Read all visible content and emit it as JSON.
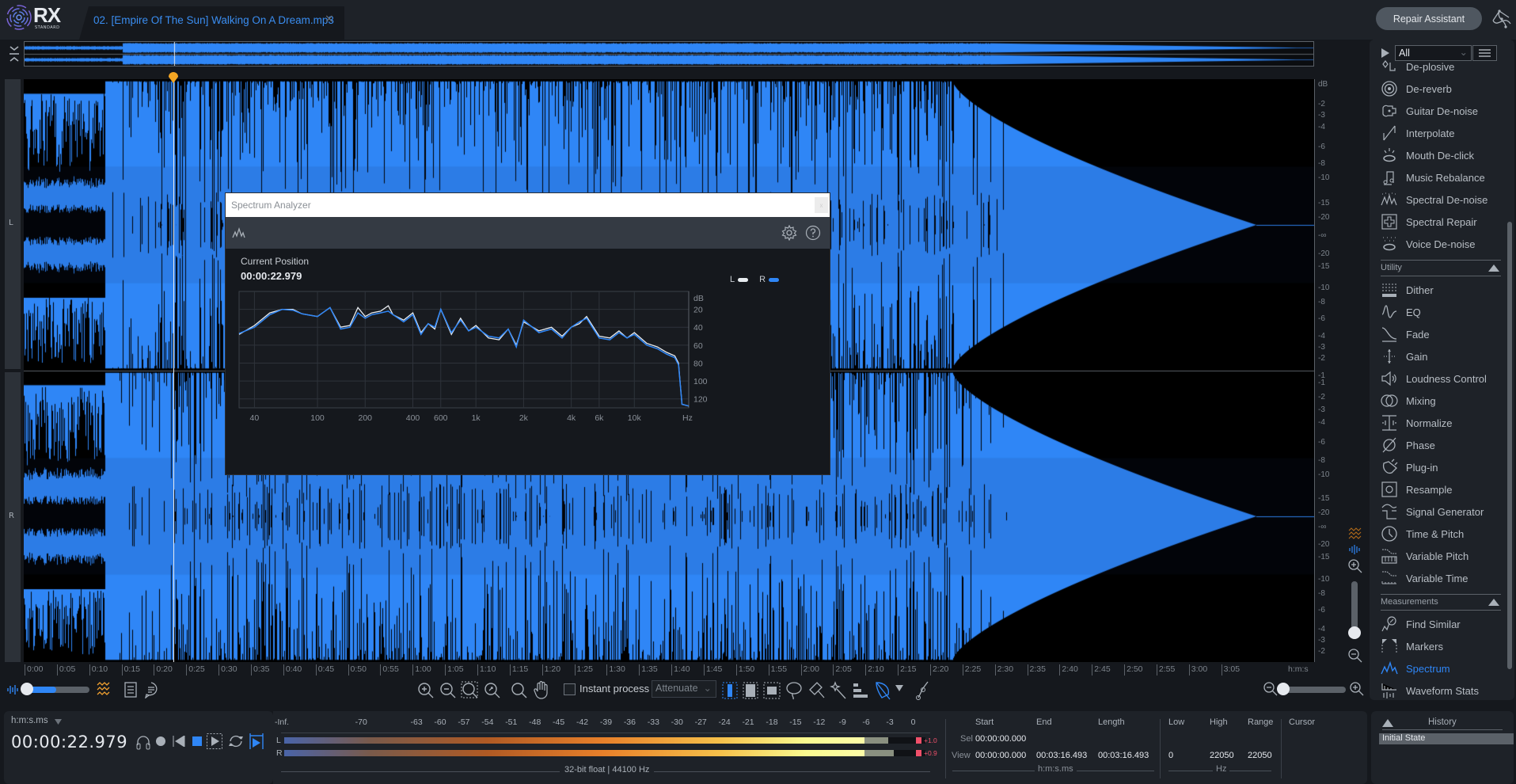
{
  "app": {
    "name": "RX",
    "edition": "STANDARD"
  },
  "tab": {
    "label": "02. [Empire Of The Sun] Walking On A Dream.mp3",
    "close_icon": "×"
  },
  "header": {
    "repair_assistant_label": "Repair Assistant"
  },
  "waveform": {
    "channels": [
      "L",
      "R"
    ],
    "playhead_time": "00:00:22.979",
    "db_ticks_top": [
      "dB",
      "-2",
      "-3",
      "-4",
      "-6",
      "-8",
      "-10",
      "-15",
      "-20",
      "-∞",
      "-20",
      "-15",
      "-10",
      "-8",
      "-6",
      "-4",
      "-3",
      "-2",
      "-1"
    ],
    "db_ticks_bottom": [
      "-1",
      "-2",
      "-3",
      "-4",
      "-6",
      "-8",
      "-10",
      "-15",
      "-20",
      "-∞",
      "-20",
      "-15",
      "-10",
      "-8",
      "-6",
      "-4",
      "-3",
      "-2",
      "-1"
    ],
    "time_ticks": [
      "0:00",
      "0:05",
      "0:10",
      "0:15",
      "0:20",
      "0:25",
      "0:30",
      "0:35",
      "0:40",
      "0:45",
      "0:50",
      "0:55",
      "1:00",
      "1:05",
      "1:10",
      "1:15",
      "1:20",
      "1:25",
      "1:30",
      "1:35",
      "1:40",
      "1:45",
      "1:50",
      "1:55",
      "2:00",
      "2:05",
      "2:10",
      "2:15",
      "2:20",
      "2:25",
      "2:30",
      "2:35",
      "2:40",
      "2:45",
      "2:50",
      "2:55",
      "3:00",
      "3:05"
    ],
    "time_unit": "h:m:s",
    "colors": {
      "wave": "#2f86f6",
      "background": "#000000",
      "playhead": "#e8ecf0",
      "marker": "#f5a623"
    }
  },
  "toolbar": {
    "instant_process_label": "Instant process",
    "instant_process_checked": false,
    "mode_select": "Attenuate"
  },
  "module_panel": {
    "filter_value": "All",
    "repair_items": [
      {
        "label": "De-plosive",
        "icon": "de-plosive-icon"
      },
      {
        "label": "De-reverb",
        "icon": "de-reverb-icon"
      },
      {
        "label": "Guitar De-noise",
        "icon": "guitar-icon"
      },
      {
        "label": "Interpolate",
        "icon": "interpolate-icon"
      },
      {
        "label": "Mouth De-click",
        "icon": "mouth-icon"
      },
      {
        "label": "Music Rebalance",
        "icon": "music-note-icon"
      },
      {
        "label": "Spectral De-noise",
        "icon": "spectral-denoise-icon"
      },
      {
        "label": "Spectral Repair",
        "icon": "spectral-repair-icon"
      },
      {
        "label": "Voice De-noise",
        "icon": "voice-denoise-icon"
      }
    ],
    "utility_title": "Utility",
    "utility_items": [
      {
        "label": "Dither",
        "icon": "dither-icon"
      },
      {
        "label": "EQ",
        "icon": "eq-icon"
      },
      {
        "label": "Fade",
        "icon": "fade-icon"
      },
      {
        "label": "Gain",
        "icon": "gain-icon"
      },
      {
        "label": "Loudness Control",
        "icon": "speaker-icon"
      },
      {
        "label": "Mixing",
        "icon": "mixing-icon"
      },
      {
        "label": "Normalize",
        "icon": "normalize-icon"
      },
      {
        "label": "Phase",
        "icon": "phase-icon"
      },
      {
        "label": "Plug-in",
        "icon": "plugin-icon"
      },
      {
        "label": "Resample",
        "icon": "resample-icon"
      },
      {
        "label": "Signal Generator",
        "icon": "signal-generator-icon"
      },
      {
        "label": "Time & Pitch",
        "icon": "clock-icon"
      },
      {
        "label": "Variable Pitch",
        "icon": "variable-pitch-icon"
      },
      {
        "label": "Variable Time",
        "icon": "variable-time-icon"
      }
    ],
    "measurements_title": "Measurements",
    "measurement_items": [
      {
        "label": "Find Similar",
        "icon": "find-similar-icon"
      },
      {
        "label": "Markers",
        "icon": "markers-icon"
      },
      {
        "label": "Spectrum",
        "icon": "spectrum-icon",
        "active": true
      },
      {
        "label": "Waveform Stats",
        "icon": "waveform-stats-icon"
      }
    ]
  },
  "transport": {
    "time_format": "h:m:s.ms",
    "time": "00:00:22.979"
  },
  "meter": {
    "scale": [
      "-Inf.",
      "-70",
      "-63",
      "-60",
      "-57",
      "-54",
      "-51",
      "-48",
      "-45",
      "-42",
      "-39",
      "-36",
      "-33",
      "-30",
      "-27",
      "-24",
      "-21",
      "-18",
      "-15",
      "-12",
      "-9",
      "-6",
      "-3",
      "0"
    ],
    "channels": [
      {
        "label": "L",
        "level_db": -6.5,
        "peak_db": -3.5,
        "clip_readout": "+1.0"
      },
      {
        "label": "R",
        "level_db": -6.5,
        "peak_db": -2.8,
        "clip_readout": "+0.9"
      }
    ],
    "format": "32-bit float | 44100 Hz"
  },
  "selection": {
    "headers": [
      "Start",
      "End",
      "Length"
    ],
    "freq_headers": [
      "Low",
      "High",
      "Range"
    ],
    "cursor_header": "Cursor",
    "rows": [
      {
        "label": "Sel",
        "start": "00:00:00.000",
        "end": "",
        "length": "",
        "low": "",
        "high": "",
        "range": ""
      },
      {
        "label": "View",
        "start": "00:00:00.000",
        "end": "00:03:16.493",
        "length": "00:03:16.493",
        "low": "0",
        "high": "22050",
        "range": "22050"
      }
    ],
    "time_unit": "h:m:s.ms",
    "freq_unit": "Hz"
  },
  "history": {
    "title": "History",
    "items": [
      "Initial State"
    ]
  },
  "spectrum_analyzer": {
    "title": "Spectrum Analyzer",
    "close_label": "x",
    "position_label": "Current Position",
    "position_time": "00:00:22.979",
    "legend": [
      {
        "label": "L",
        "color": "#e8ecf0"
      },
      {
        "label": "R",
        "color": "#2f86f6"
      }
    ]
  },
  "chart_data": {
    "type": "line",
    "title": "Spectrum Analyzer",
    "xlabel": "Hz",
    "ylabel": "dB",
    "x_scale": "log",
    "xlim": [
      32,
      22050
    ],
    "ylim": [
      -130,
      0
    ],
    "x_ticks": [
      40,
      100,
      200,
      400,
      600,
      1000,
      2000,
      4000,
      6000,
      10000
    ],
    "x_tick_labels": [
      "40",
      "100",
      "200",
      "400",
      "600",
      "1k",
      "2k",
      "4k",
      "6k",
      "10k"
    ],
    "y_ticks": [
      -20,
      -40,
      -60,
      -80,
      -100,
      -120
    ],
    "y_tick_labels": [
      "20",
      "40",
      "60",
      "80",
      "100",
      "120"
    ],
    "grid": true,
    "legend_position": "top-right",
    "series": [
      {
        "name": "L",
        "color": "#e8ecf0",
        "x": [
          32,
          40,
          50,
          60,
          70,
          80,
          100,
          120,
          140,
          160,
          180,
          200,
          220,
          250,
          280,
          300,
          350,
          400,
          450,
          500,
          550,
          600,
          700,
          800,
          900,
          1000,
          1200,
          1400,
          1600,
          1800,
          2000,
          2500,
          3000,
          3500,
          4000,
          4500,
          5000,
          6000,
          7000,
          8000,
          9000,
          10000,
          12000,
          14000,
          16000,
          18000,
          19000,
          20000,
          22050
        ],
        "y": [
          -48,
          -38,
          -24,
          -20,
          -20,
          -25,
          -28,
          -18,
          -40,
          -38,
          -18,
          -28,
          -24,
          -22,
          -16,
          -26,
          -32,
          -24,
          -46,
          -36,
          -42,
          -20,
          -48,
          -30,
          -44,
          -38,
          -52,
          -54,
          -42,
          -60,
          -34,
          -44,
          -40,
          -50,
          -40,
          -36,
          -28,
          -50,
          -52,
          -44,
          -52,
          -46,
          -58,
          -62,
          -68,
          -72,
          -80,
          -126,
          -128
        ]
      },
      {
        "name": "R",
        "color": "#2f86f6",
        "x": [
          32,
          40,
          50,
          60,
          70,
          80,
          100,
          120,
          140,
          160,
          180,
          200,
          220,
          250,
          280,
          300,
          350,
          400,
          450,
          500,
          550,
          600,
          700,
          800,
          900,
          1000,
          1200,
          1400,
          1600,
          1800,
          2000,
          2500,
          3000,
          3500,
          4000,
          4500,
          5000,
          6000,
          7000,
          8000,
          9000,
          10000,
          12000,
          14000,
          16000,
          18000,
          19000,
          20000,
          22050
        ],
        "y": [
          -47,
          -40,
          -26,
          -20,
          -21,
          -25,
          -28,
          -18,
          -42,
          -40,
          -24,
          -30,
          -26,
          -24,
          -22,
          -26,
          -34,
          -26,
          -48,
          -36,
          -40,
          -20,
          -46,
          -32,
          -44,
          -40,
          -50,
          -52,
          -42,
          -62,
          -32,
          -46,
          -42,
          -52,
          -40,
          -34,
          -30,
          -52,
          -54,
          -46,
          -52,
          -48,
          -60,
          -64,
          -70,
          -74,
          -82,
          -126,
          -128
        ]
      }
    ]
  }
}
